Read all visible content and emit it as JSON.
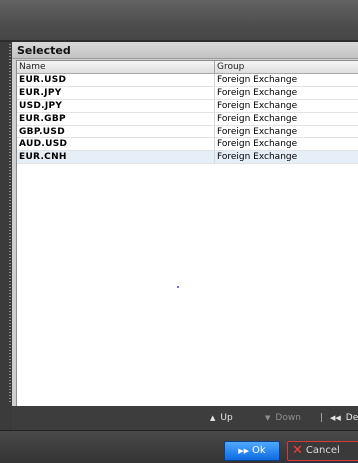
{
  "panel": {
    "title": "Selected"
  },
  "columns": {
    "name": "Name",
    "group": "Group"
  },
  "rows": [
    {
      "name": "EUR.USD",
      "group": "Foreign Exchange"
    },
    {
      "name": "EUR.JPY",
      "group": "Foreign Exchange"
    },
    {
      "name": "USD.JPY",
      "group": "Foreign Exchange"
    },
    {
      "name": "EUR.GBP",
      "group": "Foreign Exchange"
    },
    {
      "name": "GBP.USD",
      "group": "Foreign Exchange"
    },
    {
      "name": "AUD.USD",
      "group": "Foreign Exchange"
    },
    {
      "name": "EUR.CNH",
      "group": "Foreign Exchange",
      "selected": true
    }
  ],
  "toolbar": {
    "up": "Up",
    "down": "Down",
    "separator": "|",
    "delete": "Delete"
  },
  "icons": {
    "up": "triangle-up-icon",
    "down": "triangle-down-icon",
    "delete": "rewind-icon",
    "ok": "fast-forward-icon",
    "cancel": "close-x-icon"
  },
  "footer": {
    "ok": "Ok",
    "cancel": "Cancel"
  },
  "colors": {
    "ok_button": "#1f7fe8",
    "cancel_accent": "#d43a3a",
    "selected_row": "#e6eef8"
  }
}
